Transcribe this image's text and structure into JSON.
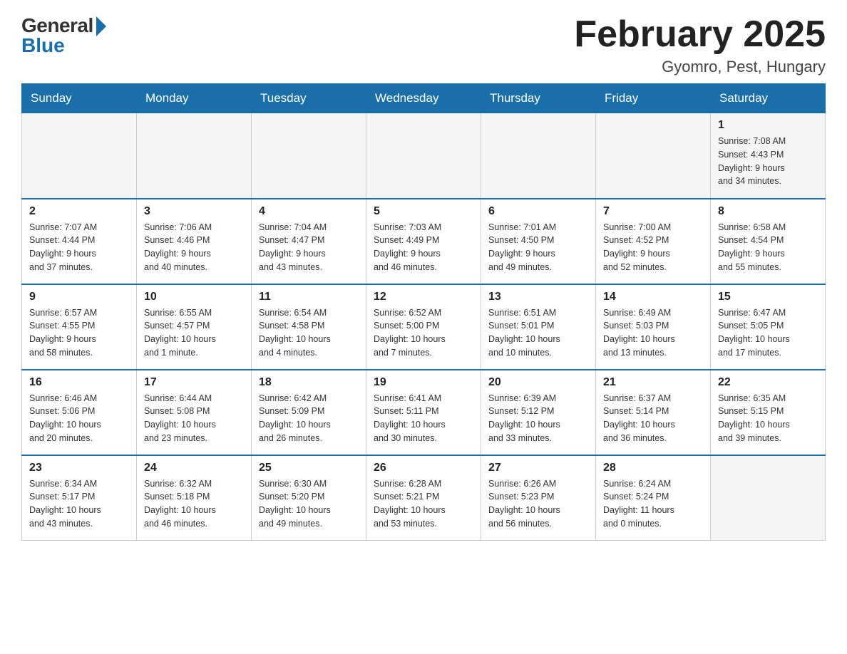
{
  "logo": {
    "general": "General",
    "blue": "Blue"
  },
  "title": {
    "month_year": "February 2025",
    "location": "Gyomro, Pest, Hungary"
  },
  "weekdays": [
    "Sunday",
    "Monday",
    "Tuesday",
    "Wednesday",
    "Thursday",
    "Friday",
    "Saturday"
  ],
  "weeks": [
    {
      "days": [
        {
          "number": "",
          "info": ""
        },
        {
          "number": "",
          "info": ""
        },
        {
          "number": "",
          "info": ""
        },
        {
          "number": "",
          "info": ""
        },
        {
          "number": "",
          "info": ""
        },
        {
          "number": "",
          "info": ""
        },
        {
          "number": "1",
          "info": "Sunrise: 7:08 AM\nSunset: 4:43 PM\nDaylight: 9 hours\nand 34 minutes."
        }
      ]
    },
    {
      "days": [
        {
          "number": "2",
          "info": "Sunrise: 7:07 AM\nSunset: 4:44 PM\nDaylight: 9 hours\nand 37 minutes."
        },
        {
          "number": "3",
          "info": "Sunrise: 7:06 AM\nSunset: 4:46 PM\nDaylight: 9 hours\nand 40 minutes."
        },
        {
          "number": "4",
          "info": "Sunrise: 7:04 AM\nSunset: 4:47 PM\nDaylight: 9 hours\nand 43 minutes."
        },
        {
          "number": "5",
          "info": "Sunrise: 7:03 AM\nSunset: 4:49 PM\nDaylight: 9 hours\nand 46 minutes."
        },
        {
          "number": "6",
          "info": "Sunrise: 7:01 AM\nSunset: 4:50 PM\nDaylight: 9 hours\nand 49 minutes."
        },
        {
          "number": "7",
          "info": "Sunrise: 7:00 AM\nSunset: 4:52 PM\nDaylight: 9 hours\nand 52 minutes."
        },
        {
          "number": "8",
          "info": "Sunrise: 6:58 AM\nSunset: 4:54 PM\nDaylight: 9 hours\nand 55 minutes."
        }
      ]
    },
    {
      "days": [
        {
          "number": "9",
          "info": "Sunrise: 6:57 AM\nSunset: 4:55 PM\nDaylight: 9 hours\nand 58 minutes."
        },
        {
          "number": "10",
          "info": "Sunrise: 6:55 AM\nSunset: 4:57 PM\nDaylight: 10 hours\nand 1 minute."
        },
        {
          "number": "11",
          "info": "Sunrise: 6:54 AM\nSunset: 4:58 PM\nDaylight: 10 hours\nand 4 minutes."
        },
        {
          "number": "12",
          "info": "Sunrise: 6:52 AM\nSunset: 5:00 PM\nDaylight: 10 hours\nand 7 minutes."
        },
        {
          "number": "13",
          "info": "Sunrise: 6:51 AM\nSunset: 5:01 PM\nDaylight: 10 hours\nand 10 minutes."
        },
        {
          "number": "14",
          "info": "Sunrise: 6:49 AM\nSunset: 5:03 PM\nDaylight: 10 hours\nand 13 minutes."
        },
        {
          "number": "15",
          "info": "Sunrise: 6:47 AM\nSunset: 5:05 PM\nDaylight: 10 hours\nand 17 minutes."
        }
      ]
    },
    {
      "days": [
        {
          "number": "16",
          "info": "Sunrise: 6:46 AM\nSunset: 5:06 PM\nDaylight: 10 hours\nand 20 minutes."
        },
        {
          "number": "17",
          "info": "Sunrise: 6:44 AM\nSunset: 5:08 PM\nDaylight: 10 hours\nand 23 minutes."
        },
        {
          "number": "18",
          "info": "Sunrise: 6:42 AM\nSunset: 5:09 PM\nDaylight: 10 hours\nand 26 minutes."
        },
        {
          "number": "19",
          "info": "Sunrise: 6:41 AM\nSunset: 5:11 PM\nDaylight: 10 hours\nand 30 minutes."
        },
        {
          "number": "20",
          "info": "Sunrise: 6:39 AM\nSunset: 5:12 PM\nDaylight: 10 hours\nand 33 minutes."
        },
        {
          "number": "21",
          "info": "Sunrise: 6:37 AM\nSunset: 5:14 PM\nDaylight: 10 hours\nand 36 minutes."
        },
        {
          "number": "22",
          "info": "Sunrise: 6:35 AM\nSunset: 5:15 PM\nDaylight: 10 hours\nand 39 minutes."
        }
      ]
    },
    {
      "days": [
        {
          "number": "23",
          "info": "Sunrise: 6:34 AM\nSunset: 5:17 PM\nDaylight: 10 hours\nand 43 minutes."
        },
        {
          "number": "24",
          "info": "Sunrise: 6:32 AM\nSunset: 5:18 PM\nDaylight: 10 hours\nand 46 minutes."
        },
        {
          "number": "25",
          "info": "Sunrise: 6:30 AM\nSunset: 5:20 PM\nDaylight: 10 hours\nand 49 minutes."
        },
        {
          "number": "26",
          "info": "Sunrise: 6:28 AM\nSunset: 5:21 PM\nDaylight: 10 hours\nand 53 minutes."
        },
        {
          "number": "27",
          "info": "Sunrise: 6:26 AM\nSunset: 5:23 PM\nDaylight: 10 hours\nand 56 minutes."
        },
        {
          "number": "28",
          "info": "Sunrise: 6:24 AM\nSunset: 5:24 PM\nDaylight: 11 hours\nand 0 minutes."
        },
        {
          "number": "",
          "info": ""
        }
      ]
    }
  ]
}
